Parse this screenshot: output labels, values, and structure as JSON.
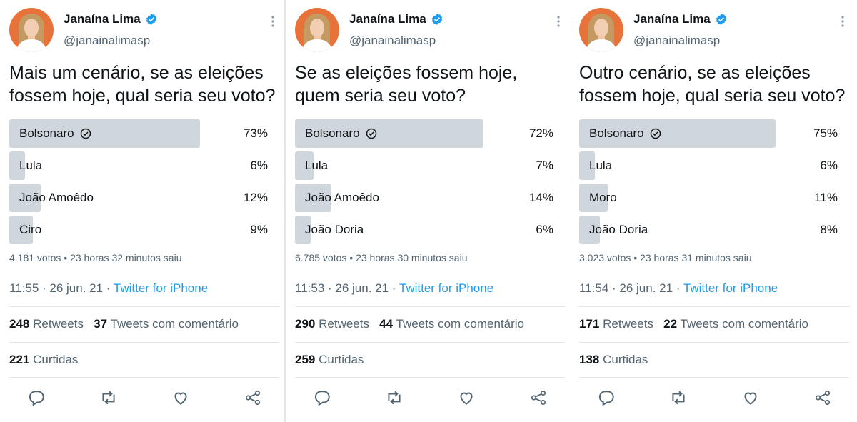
{
  "tweets": [
    {
      "author": {
        "name": "Janaína Lima",
        "handle": "@janainalimasp"
      },
      "text": "Mais um cenário, se as eleições fossem hoje, qual seria seu voto?",
      "poll": {
        "options": [
          {
            "label": "Bolsonaro",
            "pct_text": "73%",
            "pct": 73,
            "winner": true
          },
          {
            "label": "Lula",
            "pct_text": "6%",
            "pct": 6,
            "winner": false
          },
          {
            "label": "João Amoêdo",
            "pct_text": "12%",
            "pct": 12,
            "winner": false
          },
          {
            "label": "Ciro",
            "pct_text": "9%",
            "pct": 9,
            "winner": false
          }
        ],
        "meta": "4.181 votos • 23 horas 32 minutos saiu"
      },
      "time": "11:55 · 26 jun. 21 · ",
      "source": "Twitter for iPhone",
      "retweets": "248",
      "retweets_label": "Retweets",
      "quotes": "37",
      "quotes_label": "Tweets com comentário",
      "likes": "221",
      "likes_label": "Curtidas"
    },
    {
      "author": {
        "name": "Janaína Lima",
        "handle": "@janainalimasp"
      },
      "text": "Se as eleições fossem hoje, quem seria seu voto?",
      "poll": {
        "options": [
          {
            "label": "Bolsonaro",
            "pct_text": "72%",
            "pct": 72,
            "winner": true
          },
          {
            "label": "Lula",
            "pct_text": "7%",
            "pct": 7,
            "winner": false
          },
          {
            "label": "João Amoêdo",
            "pct_text": "14%",
            "pct": 14,
            "winner": false
          },
          {
            "label": "João Doria",
            "pct_text": "6%",
            "pct": 6,
            "winner": false
          }
        ],
        "meta": "6.785 votos • 23 horas 30 minutos saiu"
      },
      "time": "11:53 · 26 jun. 21 · ",
      "source": "Twitter for iPhone",
      "retweets": "290",
      "retweets_label": "Retweets",
      "quotes": "44",
      "quotes_label": "Tweets com comentário",
      "likes": "259",
      "likes_label": "Curtidas"
    },
    {
      "author": {
        "name": "Janaína Lima",
        "handle": "@janainalimasp"
      },
      "text": "Outro cenário, se as eleições fossem hoje, qual seria seu voto?",
      "poll": {
        "options": [
          {
            "label": "Bolsonaro",
            "pct_text": "75%",
            "pct": 75,
            "winner": true
          },
          {
            "label": "Lula",
            "pct_text": "6%",
            "pct": 6,
            "winner": false
          },
          {
            "label": "Moro",
            "pct_text": "11%",
            "pct": 11,
            "winner": false
          },
          {
            "label": "João Doria",
            "pct_text": "8%",
            "pct": 8,
            "winner": false
          }
        ],
        "meta": "3.023 votos • 23 horas 31 minutos saiu"
      },
      "time": "11:54 · 26 jun. 21 · ",
      "source": "Twitter for iPhone",
      "retweets": "171",
      "retweets_label": "Retweets",
      "quotes": "22",
      "quotes_label": "Tweets com comentário",
      "likes": "138",
      "likes_label": "Curtidas"
    }
  ],
  "icons": [
    "verified-badge-icon",
    "more-options-icon",
    "check-circle-icon",
    "reply-icon",
    "retweet-icon",
    "like-icon",
    "share-icon"
  ],
  "colors": {
    "verified": "#1d9bf0",
    "link": "#1d9bf0",
    "poll_bar": "#cfd6dc",
    "avatar_bg": "#e8733a",
    "muted": "#536471"
  }
}
